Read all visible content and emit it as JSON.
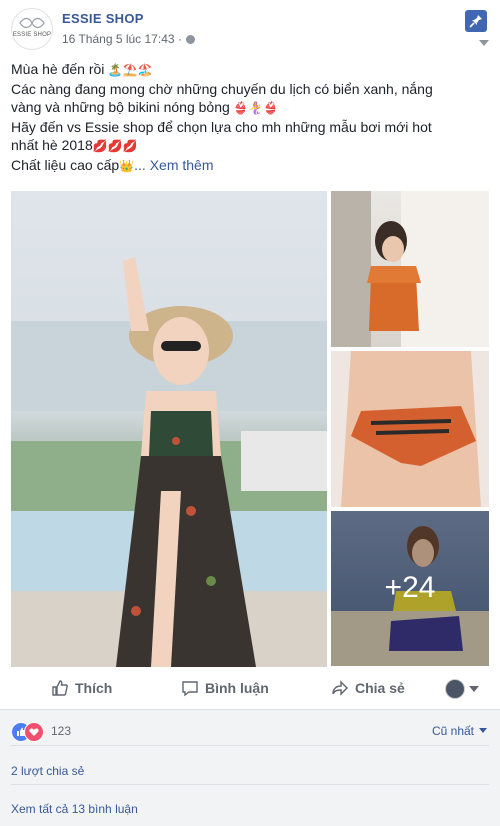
{
  "post": {
    "page_name": "ESSIE SHOP",
    "avatar_logo_text": "ESSIE SHOP",
    "timestamp": "16 Tháng 5 lúc 17:43 ·",
    "text_lines": [
      "Mùa hè đến rồi",
      "Các nàng đang mong chờ những chuyến du lịch có biển xanh, nắng",
      "vàng và những bộ bikini nóng bỏng",
      "Hãy đến vs Essie shop để chọn lựa cho mh những mẫu bơi mới hot",
      "nhất hè 2018",
      "Chất liệu cao cấp"
    ],
    "see_more": "... Xem thêm",
    "more_photos": "+24"
  },
  "actions": {
    "like": "Thích",
    "comment": "Bình luận",
    "share": "Chia sẻ"
  },
  "feedback": {
    "reaction_count": "123",
    "sort_label": "Cũ nhất",
    "shares": "2 lượt chia sẻ",
    "view_all_comments": "Xem tất cả 13 bình luận"
  },
  "colors": {
    "link": "#385898",
    "pin_bg": "#4267b2",
    "like_icon": "#4c7cf6",
    "love_icon": "#f0506e"
  }
}
